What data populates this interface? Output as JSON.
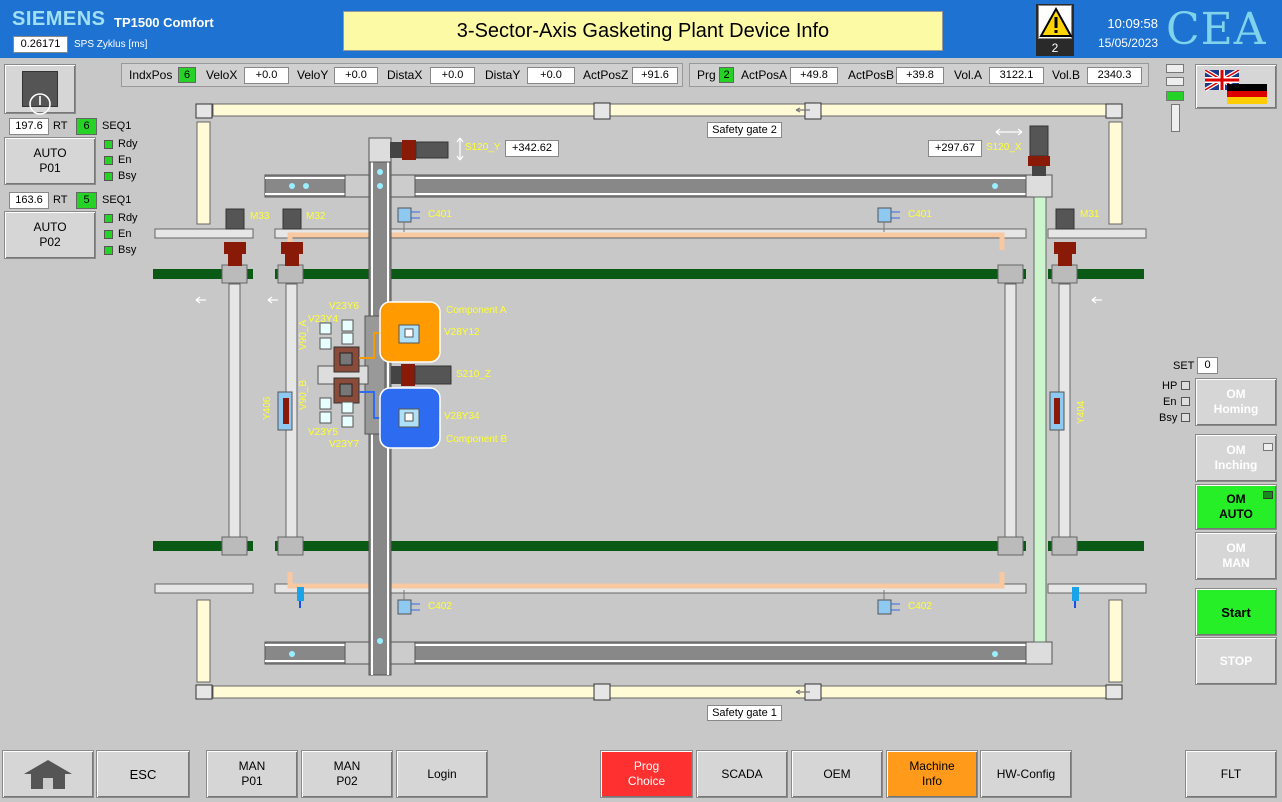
{
  "header": {
    "brand": "SIEMENS",
    "model": "TP1500 Comfort",
    "cycle_value": "0.26171",
    "cycle_label": "SPS Zyklus [ms]",
    "title": "3-Sector-Axis Gasketing Plant Device Info",
    "alarm_count": "2",
    "time": "10:09:58",
    "date": "15/05/2023",
    "logo": "CEA"
  },
  "status_bar_1": {
    "indxpos_label": "IndxPos",
    "indxpos": "6",
    "velox_label": "VeloX",
    "velox": "+0.0",
    "veloy_label": "VeloY",
    "veloy": "+0.0",
    "distax_label": "DistaX",
    "distax": "+0.0",
    "distay_label": "DistaY",
    "distay": "+0.0",
    "actposz_label": "ActPosZ",
    "actposz": "+91.6"
  },
  "status_bar_2": {
    "prg_label": "Prg",
    "prg": "2",
    "actposa_label": "ActPosA",
    "actposa": "+49.8",
    "actposb_label": "ActPosB",
    "actposb": "+39.8",
    "vola_label": "Vol.A",
    "vola": "3122.1",
    "volb_label": "Vol.B",
    "volb": "2340.3"
  },
  "left_panel": {
    "p01": {
      "value": "197.6",
      "rt": "RT",
      "seq_num": "6",
      "seq": "SEQ1",
      "button": "AUTO\nP01",
      "rdy": "Rdy",
      "en": "En",
      "bsy": "Bsy"
    },
    "p02": {
      "value": "163.6",
      "rt": "RT",
      "seq_num": "5",
      "seq": "SEQ1",
      "button": "AUTO\nP02",
      "rdy": "Rdy",
      "en": "En",
      "bsy": "Bsy"
    }
  },
  "right_panel": {
    "set_label": "SET",
    "set_value": "0",
    "hp": "HP",
    "en": "En",
    "bsy": "Bsy",
    "om_homing": "OM\nHoming",
    "om_inching": "OM\nInching",
    "om_auto": "OM\nAUTO",
    "om_man": "OM\nMAN",
    "start": "Start",
    "stop": "STOP"
  },
  "plant": {
    "gate2": "Safety gate 2",
    "gate1": "Safety gate 1",
    "s120y_label": "S120_Y",
    "s120y_value": "+342.62",
    "s120x_label": "S120_X",
    "s120x_value": "+297.67",
    "m33": "M33",
    "m32": "M32",
    "m31": "M31",
    "c401a": "C401",
    "c401b": "C401",
    "c402a": "C402",
    "c402b": "C402",
    "v23y6": "V23Y6",
    "v23y4": "V23Y4",
    "v90a": "V90_A",
    "v90b": "V90_B",
    "v23y5": "V23Y5",
    "v23y7": "V23Y7",
    "comp_a": "Component A",
    "v28y12": "V28Y12",
    "s210z": "S210_Z",
    "v28y34": "V28Y34",
    "comp_b": "Component B",
    "y406": "Y406",
    "y404": "Y404"
  },
  "footer": {
    "home": "home-icon",
    "esc": "ESC",
    "man_p01": "MAN\nP01",
    "man_p02": "MAN\nP02",
    "login": "Login",
    "prog_choice": "Prog\nChoice",
    "scada": "SCADA",
    "oem": "OEM",
    "machine_info": "Machine\nInfo",
    "hw_config": "HW-Config",
    "flt": "FLT"
  },
  "colors": {
    "header": "#1e73d2",
    "active_green": "#27d227",
    "prog_red": "#ff3030",
    "machine_orange": "#ff9a1a",
    "comp_a": "#ff9a00",
    "comp_b": "#2d6cf0"
  }
}
